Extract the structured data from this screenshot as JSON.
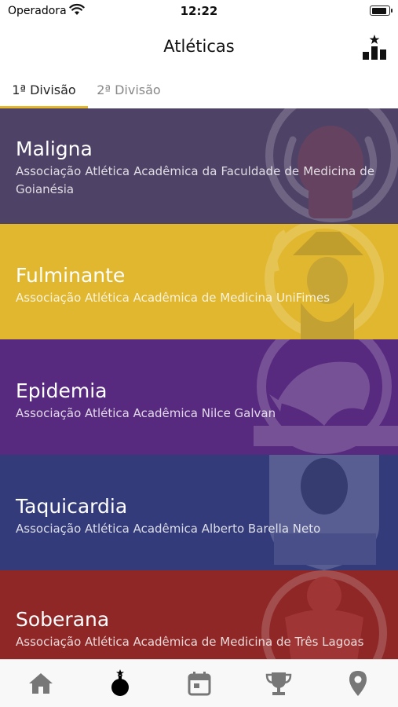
{
  "status_bar": {
    "carrier": "Operadora",
    "time": "12:22",
    "battery_level": 0.92
  },
  "nav": {
    "title": "Atléticas",
    "right_icon": "podium-star-icon"
  },
  "tabs": [
    {
      "label": "1ª Divisão",
      "selected": true
    },
    {
      "label": "2ª Divisão",
      "selected": false
    }
  ],
  "colors": {
    "accent": "#E6B72A",
    "tab_active": "#222222",
    "tab_inactive": "#888888"
  },
  "teams": [
    {
      "name": "Maligna",
      "description": "Associação Atlética Acadêmica da Faculdade de Medicina de Goianésia",
      "color": "#4F4267",
      "icon": "mammoth-mascot-logo"
    },
    {
      "name": "Fulminante",
      "description": "Associação Atlética Acadêmica de Medicina UniFimes",
      "color": "#E0B72E",
      "icon": "wizard-mascot-logo"
    },
    {
      "name": "Epidemia",
      "description": "Associação Atlética Acadêmica Nilce Galvan",
      "color": "#582A7F",
      "icon": "eagle-mascot-logo"
    },
    {
      "name": "Taquicardia",
      "description": "Associação Atlética Acadêmica Alberto Barella Neto",
      "color": "#333B7A",
      "icon": "shield-mascot-logo"
    },
    {
      "name": "Soberana",
      "description": "Associação Atlética Acadêmica de Medicina de Três Lagoas",
      "color": "#8F2727",
      "icon": "wrestler-mascot-logo"
    }
  ],
  "tab_bar": [
    {
      "icon": "home-icon",
      "active": false
    },
    {
      "icon": "bomb-star-icon",
      "active": true
    },
    {
      "icon": "calendar-icon",
      "active": false
    },
    {
      "icon": "trophy-icon",
      "active": false
    },
    {
      "icon": "location-pin-icon",
      "active": false
    }
  ]
}
